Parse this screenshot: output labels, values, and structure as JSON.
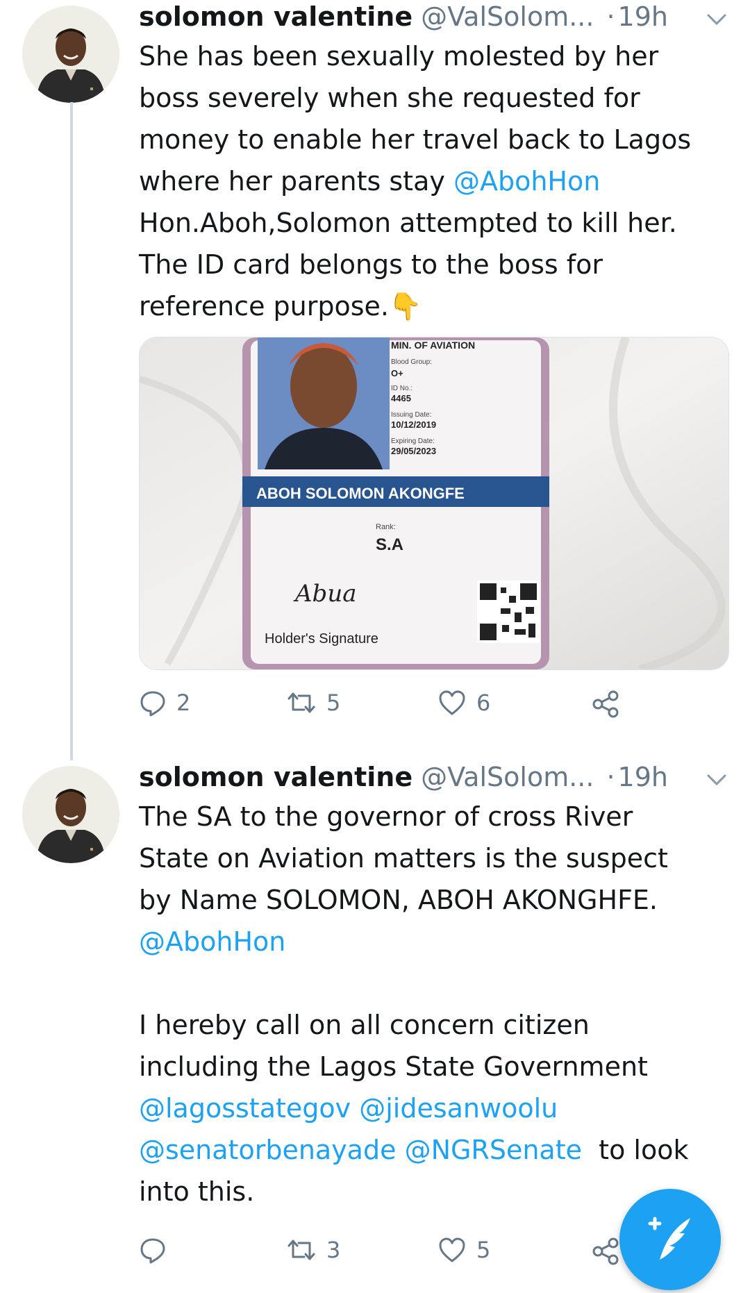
{
  "tweets": [
    {
      "name": "solomon valentine",
      "handle": "@ValSolom...",
      "separator": "·",
      "time": "19h",
      "text_lines": [
        "She has been sexually molested by her",
        "boss severely when she requested for",
        "money to enable her travel back to Lagos",
        "where her parents stay"
      ],
      "mention1": "@AbohHon",
      "text_after": [
        "Hon.Aboh,Solomon attempted to kill her.",
        "The ID card belongs to the boss for",
        "reference purpose."
      ],
      "emoji": "👇",
      "id_card": {
        "ministry": "MIN. OF AVIATION",
        "blood_group_label": "Blood Group:",
        "blood_group": "O+",
        "id_no_label": "ID No.:",
        "id_no": "4465",
        "issuing_label": "Issuing Date:",
        "issuing_date": "10/12/2019",
        "expiring_label": "Expiring Date:",
        "expiring_date": "29/05/2023",
        "holder_name": "ABOH SOLOMON AKONGFE",
        "rank_label": "Rank:",
        "rank": "S.A",
        "signature_label": "Holder's Signature",
        "signature": "Abua"
      },
      "replies": "2",
      "retweets": "5",
      "likes": "6"
    },
    {
      "name": "solomon valentine",
      "handle": "@ValSolom...",
      "separator": "·",
      "time": "19h",
      "para1": [
        "The SA to the governor of cross River",
        "State on Aviation matters is the suspect",
        "by Name SOLOMON, ABOH AKONGHFE."
      ],
      "mention1": "@AbohHon",
      "para2": [
        "I hereby call on all concern citizen",
        "including the Lagos State Government"
      ],
      "mention_a": "@lagosstategov",
      "mention_b": "@jidesanwoolu",
      "mention_c": "@senatorbenayade",
      "mention_d": "@NGRSenate",
      "text_end1": "to look",
      "text_end2": "into this.",
      "replies": "",
      "retweets": "3",
      "likes": "5"
    }
  ],
  "colors": {
    "accent": "#1da1f2",
    "muted": "#657786",
    "text": "#14171a",
    "thread_line": "#cfd9de"
  },
  "icons": [
    "chevron-down-icon",
    "reply-icon",
    "retweet-icon",
    "like-icon",
    "share-icon",
    "compose-tweet-icon"
  ]
}
